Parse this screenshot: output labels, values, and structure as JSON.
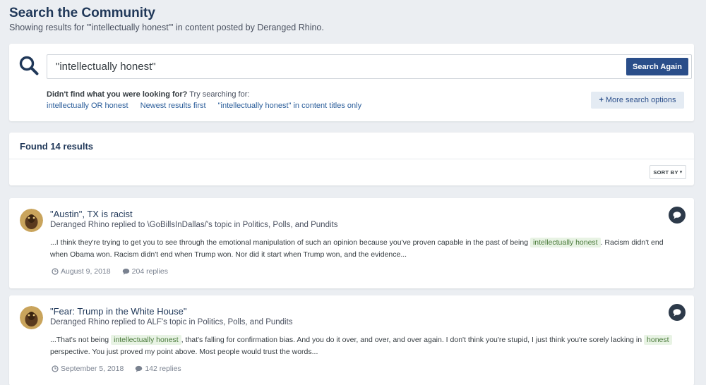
{
  "header": {
    "title": "Search the Community",
    "subtitle": "Showing results for '\"intellectually honest\"' in content posted by Deranged Rhino."
  },
  "search": {
    "value": "\"intellectually honest\"",
    "button_label": "Search Again",
    "didnt_find": "Didn't find what you were looking for?",
    "try_searching": " Try searching for:",
    "suggestions": [
      "intellectually OR honest",
      "Newest results first",
      "\"intellectually honest\" in content titles only"
    ],
    "more_options_label": "More search options"
  },
  "results_header": {
    "found": "Found 14 results",
    "sort_label": "SORT BY"
  },
  "results": [
    {
      "title": "\"Austin\", TX is racist",
      "meta": "Deranged Rhino replied to \\GoBillsInDallas/'s topic in Politics, Polls, and Pundits",
      "snippet_parts": [
        "...I think they're trying to get you to see through the emotional manipulation of such an opinion because you've proven capable in the past of being ",
        "intellectually honest",
        ". Racism didn't end when Obama won. Racism didn't end when Trump won. Nor did it start when Trump won, and the evidence..."
      ],
      "date": "August 9, 2018",
      "replies": "204 replies"
    },
    {
      "title": "\"Fear: Trump in the White House\"",
      "meta": "Deranged Rhino replied to ALF's topic in Politics, Polls, and Pundits",
      "snippet_parts": [
        "...That's not being ",
        "intellectually honest",
        ", that's falling for confirmation bias. And you do it over, and over, and over again. I don't think you're stupid, I just think you're sorely lacking in ",
        "honest",
        " perspective. You just proved my point above. Most people would trust the words..."
      ],
      "date": "September 5, 2018",
      "replies": "142 replies"
    }
  ],
  "colors": {
    "background": "#ebeef2",
    "title": "#1f3758",
    "button": "#2a4e8a",
    "link": "#2a5d9a",
    "highlight_bg": "#e8f3e4",
    "highlight_text": "#4a7a3b"
  },
  "icons": {
    "search": "search-icon",
    "plus": "plus-icon",
    "sort_caret": "caret-down-icon",
    "comment": "comment-icon",
    "clock": "clock-icon",
    "replies": "speech-bubble-icon"
  }
}
